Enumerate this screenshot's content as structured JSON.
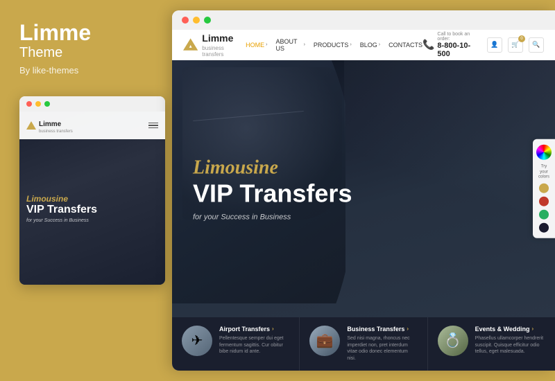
{
  "left": {
    "title": "Limme",
    "subtitle": "Theme",
    "author": "By like-themes",
    "mini_browser": {
      "dots": [
        "red",
        "yellow",
        "green"
      ],
      "logo_text": "Limme",
      "logo_sub": "business transfers",
      "hero_title1": "Limousine",
      "hero_title2": "VIP Transfers",
      "hero_sub": "for your Success in Business",
      "nav_dots": [
        {
          "active": true
        },
        {
          "active": false
        },
        {
          "active": false
        },
        {
          "active": false
        }
      ]
    }
  },
  "right": {
    "browser_dots": [
      "red",
      "yellow",
      "green"
    ],
    "nav": {
      "logo_text": "Limme",
      "logo_sub": "business transfers",
      "links": [
        {
          "label": "HOME",
          "active": true,
          "has_chevron": true
        },
        {
          "label": "ABOUT US",
          "active": false,
          "has_chevron": true
        },
        {
          "label": "PRODUCTS",
          "active": false,
          "has_chevron": true
        },
        {
          "label": "BLOG",
          "active": false,
          "has_chevron": true
        },
        {
          "label": "CONTACTS",
          "active": false,
          "has_chevron": false
        }
      ],
      "phone_small": "Call to book an order:",
      "phone_number": "8-800-10-500",
      "cart_count": "0"
    },
    "hero": {
      "title_gold": "Limousine",
      "title_white": "VIP Transfers",
      "subtitle": "for your Success in Business"
    },
    "color_panel": {
      "label": "Try your colors",
      "swatches": [
        "#c9a84c",
        "#c0392b",
        "#27ae60",
        "#2980b9",
        "#1a1a2e"
      ]
    },
    "features": [
      {
        "title": "Airport Transfers",
        "arrow": "›",
        "desc": "Pellentesque semper dui eget fermentum sagittis. Cur obitur bibe nidum id ante."
      },
      {
        "title": "Business Transfers",
        "arrow": "›",
        "desc": "Sed nisi magna, rhoncus nec imperdiet non, pret interdum vitae odio donec elementum nisi."
      },
      {
        "title": "Events & Wedding",
        "arrow": "›",
        "desc": "Phasellus ullamcorper hendrerit suscipit. Quisque efficitur odio tellus, eget malesuada."
      }
    ]
  }
}
